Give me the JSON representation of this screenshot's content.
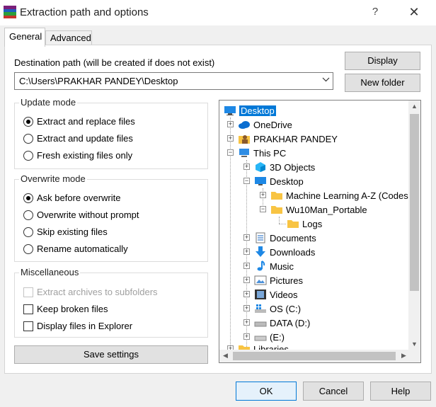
{
  "window": {
    "title": "Extraction path and options",
    "help_glyph": "?",
    "close_glyph": "✕"
  },
  "tabs": [
    {
      "label": "General"
    },
    {
      "label": "Advanced"
    }
  ],
  "destination": {
    "label": "Destination path (will be created if does not exist)",
    "value": "C:\\Users\\PRAKHAR PANDEY\\Desktop",
    "display_button": "Display",
    "new_folder_button": "New folder"
  },
  "update_mode": {
    "title": "Update mode",
    "options": [
      "Extract and replace files",
      "Extract and update files",
      "Fresh existing files only"
    ],
    "selected": 0
  },
  "overwrite_mode": {
    "title": "Overwrite mode",
    "options": [
      "Ask before overwrite",
      "Overwrite without prompt",
      "Skip existing files",
      "Rename automatically"
    ],
    "selected": 0
  },
  "misc": {
    "title": "Miscellaneous",
    "options": [
      "Extract archives to subfolders",
      "Keep broken files",
      "Display files in Explorer"
    ]
  },
  "save_settings": "Save settings",
  "tree": {
    "items": [
      "Desktop",
      "OneDrive",
      "PRAKHAR PANDEY",
      "This PC",
      "3D Objects",
      "Desktop",
      "Machine Learning A-Z (Codes",
      "Wu10Man_Portable",
      "Logs",
      "Documents",
      "Downloads",
      "Music",
      "Pictures",
      "Videos",
      "OS (C:)",
      "DATA (D:)",
      "(E:)",
      "Libraries"
    ]
  },
  "footer": {
    "ok": "OK",
    "cancel": "Cancel",
    "help": "Help"
  },
  "colors": {
    "selection": "#0078d7",
    "folder": "#f8c443",
    "primary_border": "#0078d7"
  }
}
